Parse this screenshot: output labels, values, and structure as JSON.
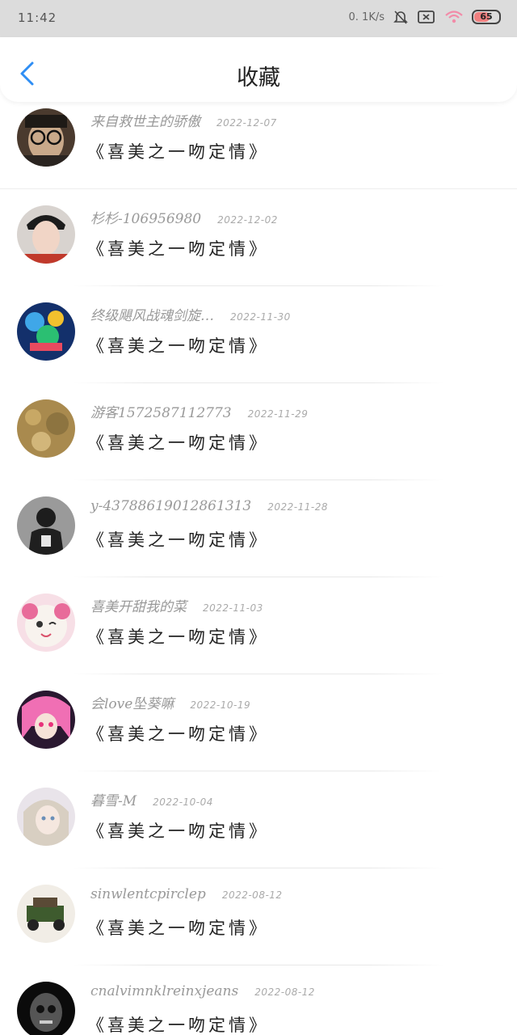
{
  "status_bar": {
    "time": "11:42",
    "speed": "0. 1K/s",
    "battery": "65"
  },
  "header": {
    "title": "收藏"
  },
  "favorites": [
    {
      "username": "来自救世主的骄傲",
      "date": "2022-12-07",
      "song": "《喜美之一吻定情》"
    },
    {
      "username": "杉杉-106956980",
      "date": "2022-12-02",
      "song": "《喜美之一吻定情》"
    },
    {
      "username": "终级飓风战魂剑旋…",
      "date": "2022-11-30",
      "song": "《喜美之一吻定情》"
    },
    {
      "username": "游客1572587112773",
      "date": "2022-11-29",
      "song": "《喜美之一吻定情》"
    },
    {
      "username": "y-43788619012861313",
      "date": "2022-11-28",
      "song": "《喜美之一吻定情》"
    },
    {
      "username": "喜美开甜我的菜",
      "date": "2022-11-03",
      "song": "《喜美之一吻定情》"
    },
    {
      "username": "会love坠葵嘛",
      "date": "2022-10-19",
      "song": "《喜美之一吻定情》"
    },
    {
      "username": "暮雪-M",
      "date": "2022-10-04",
      "song": "《喜美之一吻定情》"
    },
    {
      "username": "sinwlentcpirclep",
      "date": "2022-08-12",
      "song": "《喜美之一吻定情》"
    },
    {
      "username": "cnalvimnklreinxjeans",
      "date": "2022-08-12",
      "song": "《喜美之一吻定情》"
    }
  ],
  "colors": {
    "accent": "#2f8ef4",
    "status_bar_bg": "#dcdcdc"
  }
}
